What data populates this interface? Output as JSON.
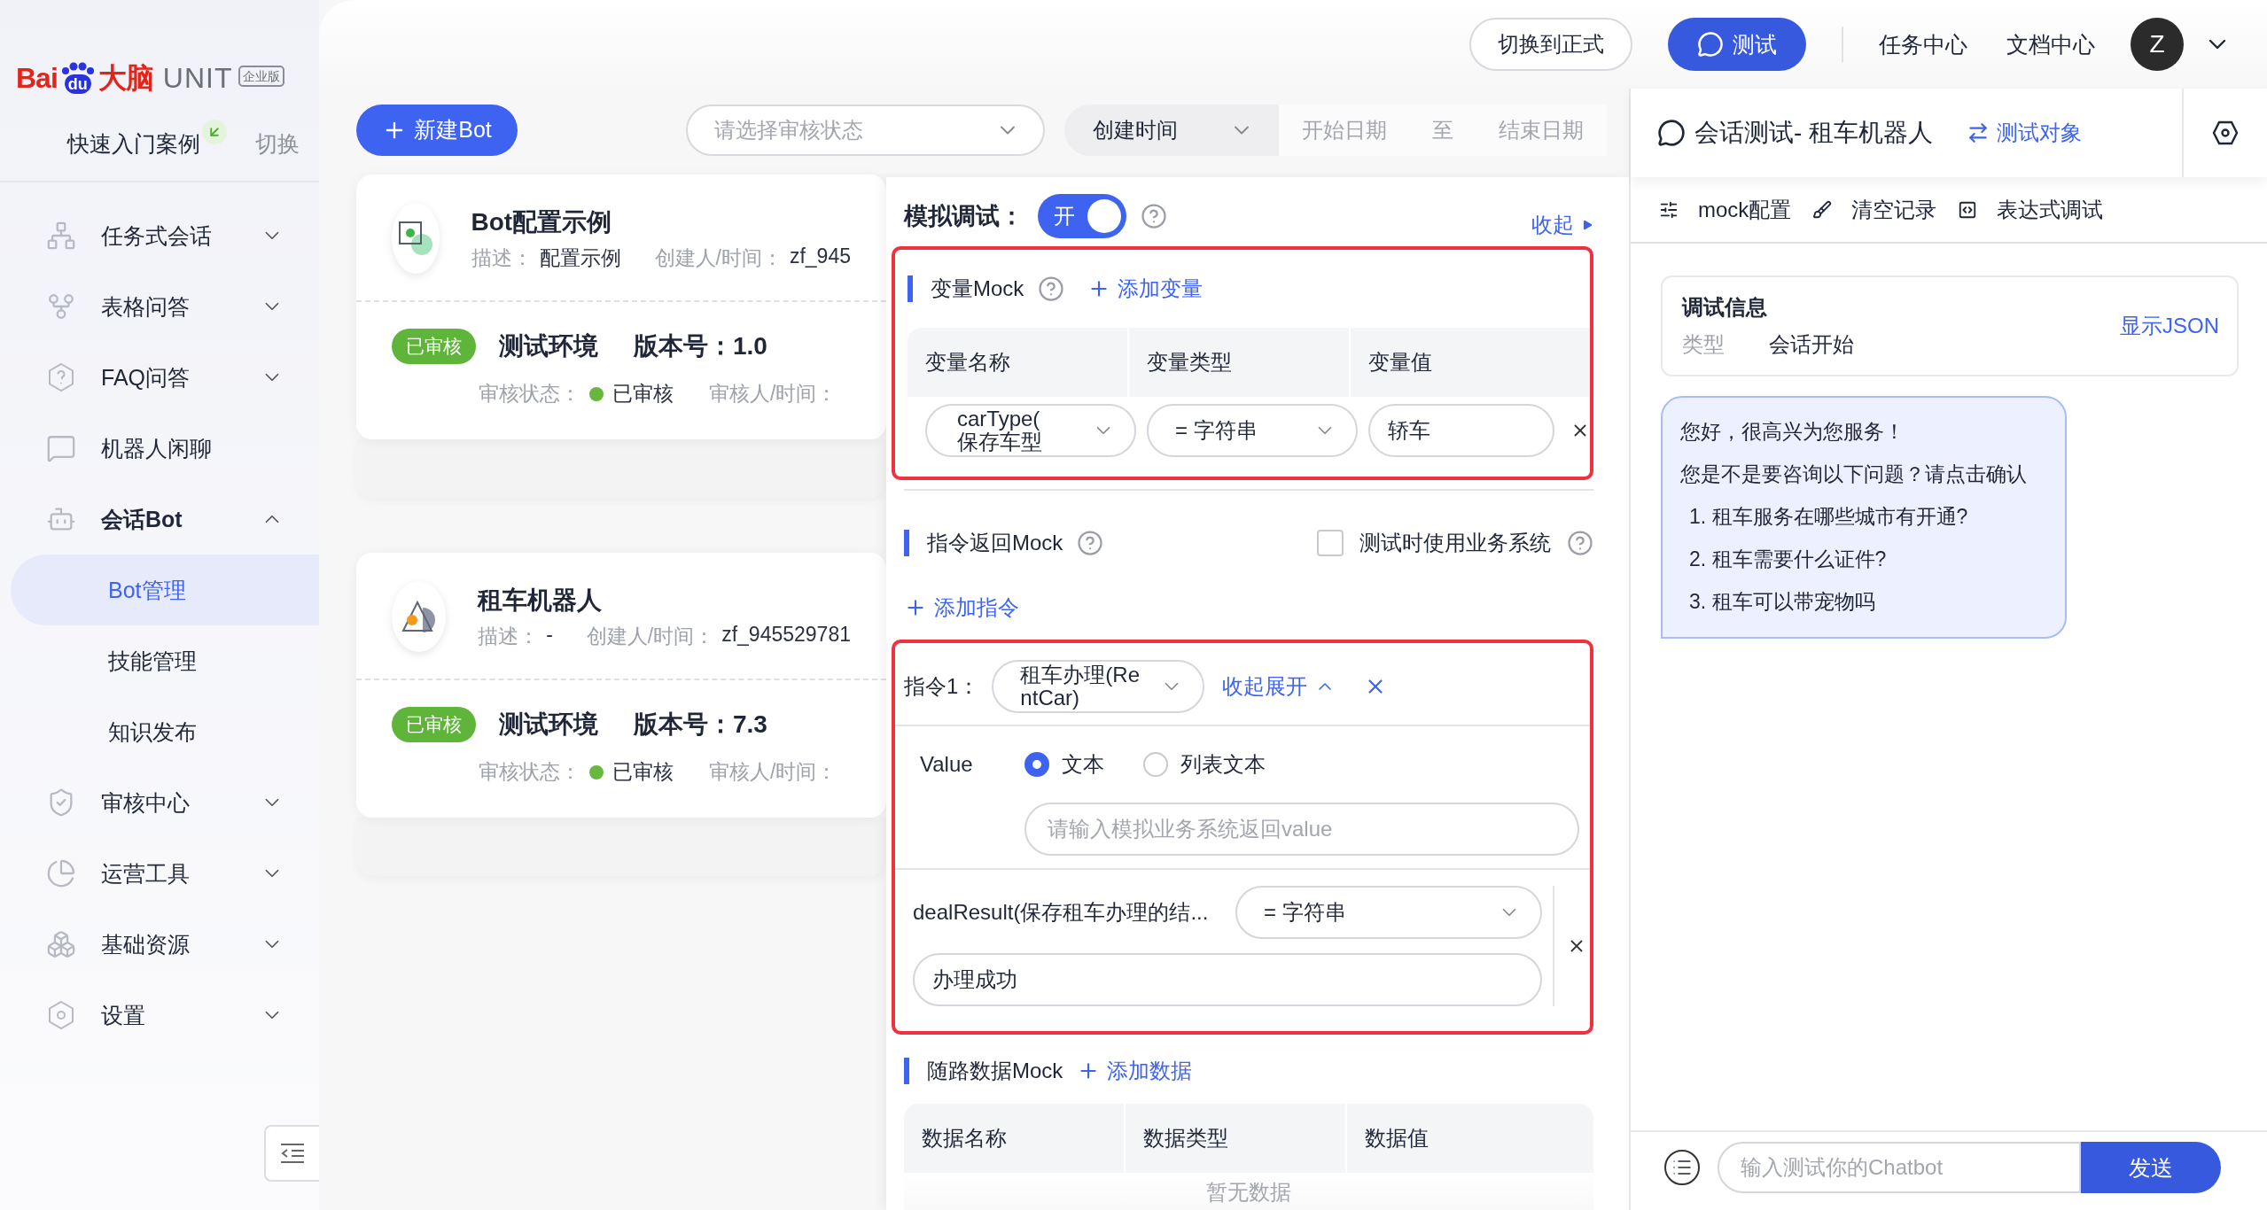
{
  "sidebar": {
    "logo": {
      "brand": "Bai",
      "paw": "du",
      "brand_cn": "大脑",
      "product": "UNIT",
      "edition": "企业版"
    },
    "quick_start": {
      "label": "快速入门案例",
      "switch": "切换"
    },
    "menu": [
      {
        "label": "任务式会话",
        "kind": "group",
        "expanded": false
      },
      {
        "label": "表格问答",
        "kind": "group",
        "expanded": false
      },
      {
        "label": "FAQ问答",
        "kind": "group",
        "expanded": false
      },
      {
        "label": "机器人闲聊",
        "kind": "link"
      },
      {
        "label": "会话Bot",
        "kind": "group",
        "expanded": true,
        "children": [
          {
            "label": "Bot管理",
            "selected": true
          },
          {
            "label": "技能管理",
            "selected": false
          },
          {
            "label": "知识发布",
            "selected": false
          }
        ]
      },
      {
        "label": "审核中心",
        "kind": "group",
        "expanded": false
      },
      {
        "label": "运营工具",
        "kind": "group",
        "expanded": false
      },
      {
        "label": "基础资源",
        "kind": "group",
        "expanded": false
      },
      {
        "label": "设置",
        "kind": "group",
        "expanded": false
      }
    ]
  },
  "header": {
    "switch_button": "切换到正式",
    "test_button": "测试",
    "links": [
      "任务中心",
      "文档中心"
    ],
    "avatar": "Z"
  },
  "toolbar": {
    "new_button": "新建Bot",
    "status_select": {
      "placeholder": "请选择审核状态"
    },
    "sort_select": {
      "value": "创建时间"
    },
    "date_range": {
      "start_placeholder": "开始日期",
      "separator": "至",
      "end_placeholder": "结束日期"
    }
  },
  "cards": [
    {
      "title": "Bot配置示例",
      "desc_label": "描述：",
      "desc": "配置示例",
      "creator_label": "创建人/时间：",
      "creator": "zf_945",
      "badge": "已审核",
      "env": "测试环境",
      "version_label": "版本号：",
      "version": "1.0",
      "review_label": "审核状态：",
      "review_status": "已审核",
      "reviewer_label": "审核人/时间："
    },
    {
      "title": "租车机器人",
      "desc_label": "描述：",
      "desc": "-",
      "creator_label": "创建人/时间：",
      "creator": "zf_945529781",
      "badge": "已审核",
      "env": "测试环境",
      "version_label": "版本号：",
      "version": "7.3",
      "review_label": "审核状态：",
      "review_status": "已审核",
      "reviewer_label": "审核人/时间："
    }
  ],
  "mock_panel": {
    "title": "模拟调试：",
    "toggle": {
      "on": true,
      "label": "开"
    },
    "collapse": "收起",
    "variables": {
      "title": "变量Mock",
      "add": "添加变量",
      "columns": [
        "变量名称",
        "变量类型",
        "变量值"
      ],
      "rows": [
        {
          "name": "carType(保存车型",
          "type": "= 字符串",
          "value": "轿车"
        }
      ]
    },
    "commands": {
      "title": "指令返回Mock",
      "use_system": {
        "label": "测试时使用业务系统",
        "checked": false
      },
      "add": "添加指令",
      "items": [
        {
          "label": "指令1：",
          "command": "租车办理(RentCar)",
          "toggle": "收起展开",
          "value_label": "Value",
          "options": [
            {
              "label": "文本",
              "selected": true
            },
            {
              "label": "列表文本",
              "selected": false
            }
          ],
          "value_placeholder": "请输入模拟业务系统返回value",
          "slots": [
            {
              "name": "dealResult(保存租车办理的结...",
              "type": "= 字符串",
              "value": "办理成功"
            }
          ]
        }
      ]
    },
    "route_data": {
      "title": "随路数据Mock",
      "add": "添加数据",
      "columns": [
        "数据名称",
        "数据类型",
        "数据值"
      ],
      "empty": "暂无数据"
    }
  },
  "chat": {
    "title": "会话测试- 租车机器人",
    "switch_target": "测试对象",
    "tools": [
      "mock配置",
      "清空记录",
      "表达式调试"
    ],
    "debug": {
      "title": "调试信息",
      "type_label": "类型",
      "type_value": "会话开始",
      "show_json": "显示JSON"
    },
    "messages": [
      {
        "lines": [
          "您好，很高兴为您服务！",
          "您是不是要咨询以下问题？请点击确认"
        ],
        "options": [
          "1. 租车服务在哪些城市有开通?",
          "2. 租车需要什么证件?",
          "3. 租车可以带宠物吗"
        ]
      }
    ],
    "input": {
      "placeholder": "输入测试你的Chatbot"
    },
    "send": "发送"
  }
}
